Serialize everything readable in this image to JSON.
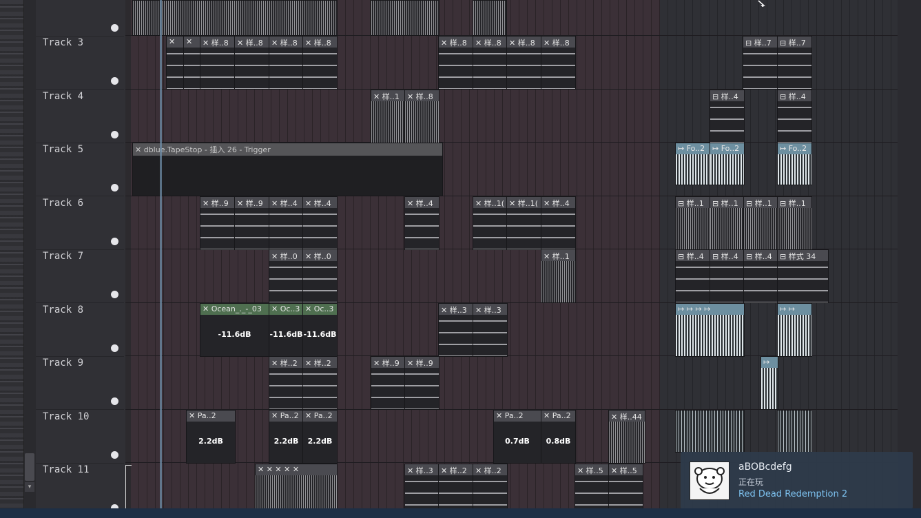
{
  "tracks": [
    {
      "name": "Track 3"
    },
    {
      "name": "Track 4"
    },
    {
      "name": "Track 5"
    },
    {
      "name": "Track 6"
    },
    {
      "name": "Track 7"
    },
    {
      "name": "Track 8"
    },
    {
      "name": "Track 9"
    },
    {
      "name": "Track 10"
    },
    {
      "name": "Track 11"
    }
  ],
  "clips": {
    "t3a": "✕ 样..8",
    "t3b": "✕ 样..8",
    "t3c": "✕ 样..8",
    "t3d": "✕ 样..8",
    "t3e": "✕ 样..8",
    "t3f": "✕ 样..8",
    "t3g": "✕ 样..8",
    "t3h": "✕ 样..8",
    "t3i": "⊟ 样..7",
    "t3j": "⊟ 样..7",
    "t4a": "✕ 样..1",
    "t4b": "✕ 样..8",
    "t4c": "⊟ 样..4",
    "t4d": "⊟ 样..4",
    "t5a": "✕ dblue.TapeStop - 插入 26 - Trigger",
    "t5b": "↦ Fo..2",
    "t5c": "↦ Fo..2",
    "t5d": "↦ Fo..2",
    "t6a": "✕ 样..9",
    "t6b": "✕ 样..9",
    "t6c": "✕ 样..4",
    "t6d": "✕ 样..4",
    "t6e": "✕ 样..4",
    "t6f": "✕ 样..1(",
    "t6g": "✕ 样..1(",
    "t6h": "✕ 样..4",
    "t6i": "⊟ 样..1",
    "t6j": "⊟ 样..1",
    "t6k": "⊟ 样..1",
    "t6l": "⊟ 样..1",
    "t7a": "✕ 样..0",
    "t7b": "✕ 样..0",
    "t7c": "✕ 样..1",
    "t7d": "⊟ 样..4",
    "t7e": "⊟ 样..4",
    "t7f": "⊟ 样..4",
    "t7g": "⊟ 样式 34",
    "t8a": "✕ Ocean_._-_03",
    "t8b": "✕ Oc..3",
    "t8c": "✕ Oc..3",
    "t8d": "✕ 样..3",
    "t8e": "✕ 样..3",
    "t8a_db": "-11.6dB",
    "t8b_db": "-11.6dB",
    "t8c_db": "-11.6dB",
    "t9a": "✕ 样..2",
    "t9b": "✕ 样..2",
    "t9c": "✕ 样..9",
    "t9d": "✕ 样..9",
    "t10a": "✕ Pa..2",
    "t10b": "✕ Pa..2",
    "t10c": "✕ Pa..2",
    "t10d": "✕ Pa..2",
    "t10e": "✕ Pa..2",
    "t10f": "✕ 样..44",
    "t10a_db": "2.2dB",
    "t10b_db": "2.2dB",
    "t10c_db": "2.2dB",
    "t10d_db": "0.7dB",
    "t10e_db": "0.8dB",
    "t11a": "✕ 样..3",
    "t11b": "✕ 样..2",
    "t11c": "✕ 样..2",
    "t11d": "✕ 样..5",
    "t11e": "✕ 样..5"
  },
  "notification": {
    "username": "aBOBcdefg",
    "status": "正在玩",
    "game": "Red Dead Redemption 2"
  },
  "colors": {
    "accent_blue_clip": "#6d8fa0",
    "notification_bg": "#2e3a4a",
    "game_link": "#7dc2f0"
  }
}
